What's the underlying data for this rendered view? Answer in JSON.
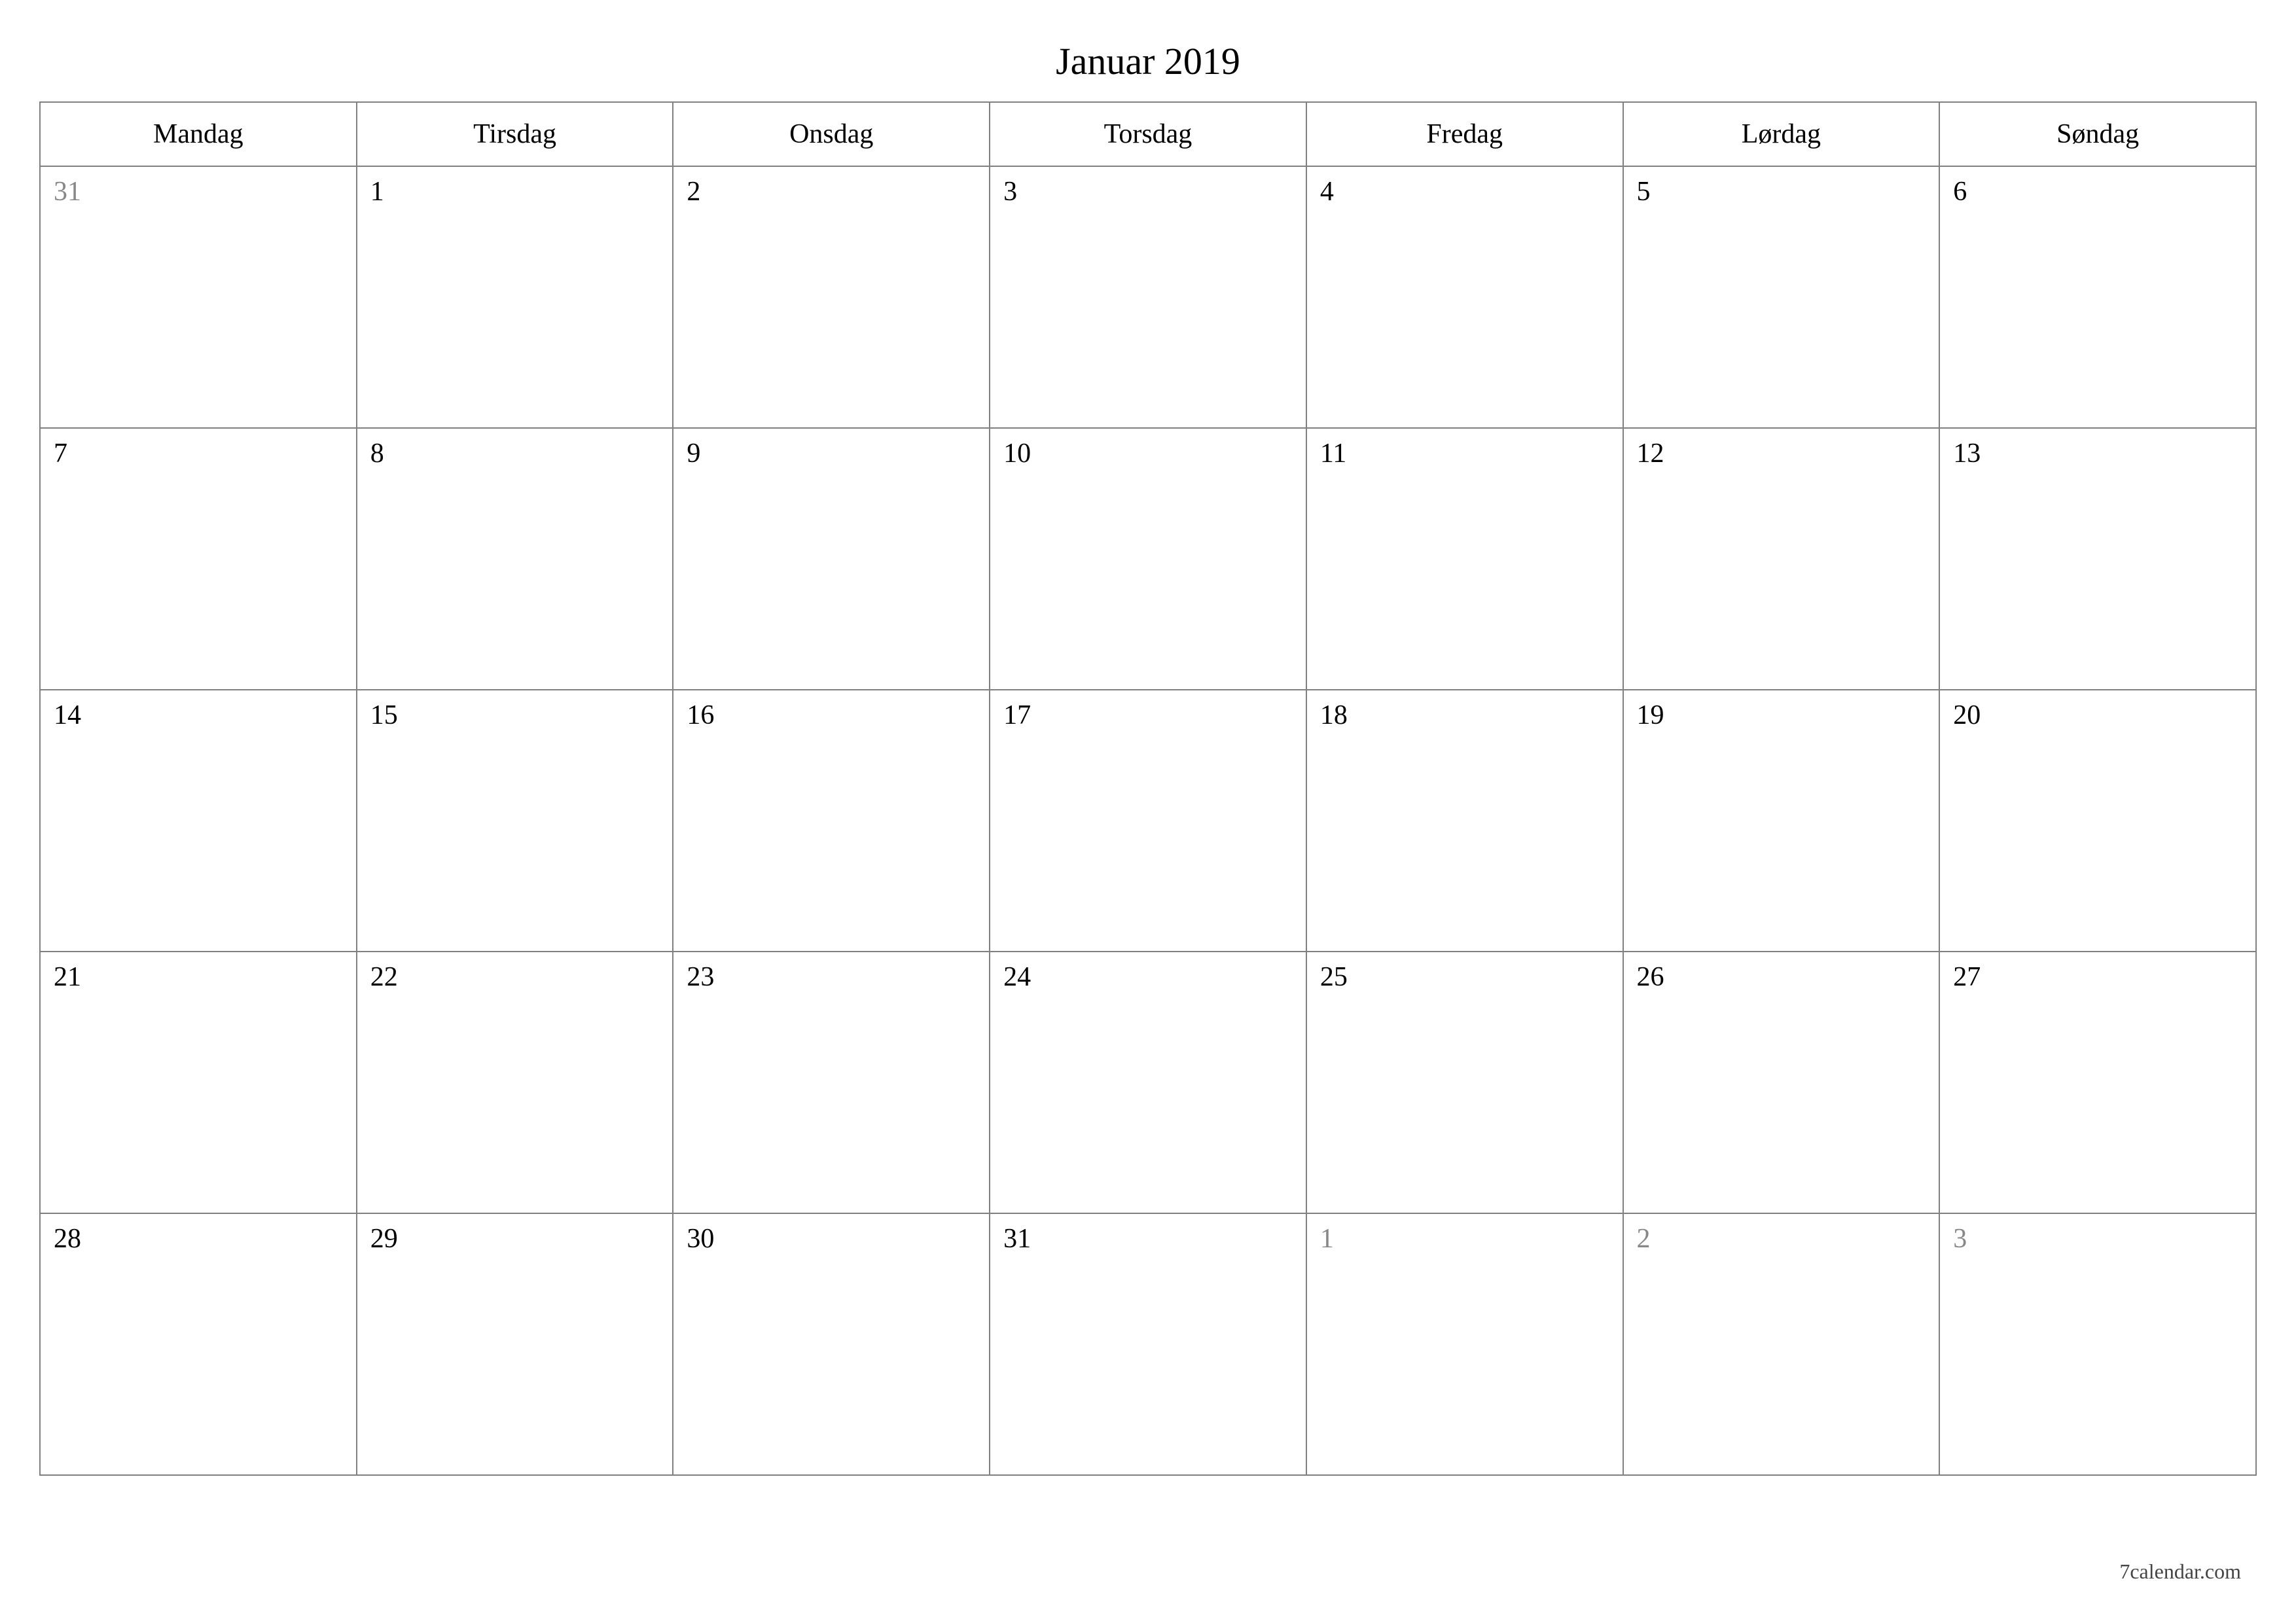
{
  "title": "Januar 2019",
  "weekdays": [
    "Mandag",
    "Tirsdag",
    "Onsdag",
    "Torsdag",
    "Fredag",
    "Lørdag",
    "Søndag"
  ],
  "weeks": [
    [
      {
        "day": "31",
        "other": true
      },
      {
        "day": "1",
        "other": false
      },
      {
        "day": "2",
        "other": false
      },
      {
        "day": "3",
        "other": false
      },
      {
        "day": "4",
        "other": false
      },
      {
        "day": "5",
        "other": false
      },
      {
        "day": "6",
        "other": false
      }
    ],
    [
      {
        "day": "7",
        "other": false
      },
      {
        "day": "8",
        "other": false
      },
      {
        "day": "9",
        "other": false
      },
      {
        "day": "10",
        "other": false
      },
      {
        "day": "11",
        "other": false
      },
      {
        "day": "12",
        "other": false
      },
      {
        "day": "13",
        "other": false
      }
    ],
    [
      {
        "day": "14",
        "other": false
      },
      {
        "day": "15",
        "other": false
      },
      {
        "day": "16",
        "other": false
      },
      {
        "day": "17",
        "other": false
      },
      {
        "day": "18",
        "other": false
      },
      {
        "day": "19",
        "other": false
      },
      {
        "day": "20",
        "other": false
      }
    ],
    [
      {
        "day": "21",
        "other": false
      },
      {
        "day": "22",
        "other": false
      },
      {
        "day": "23",
        "other": false
      },
      {
        "day": "24",
        "other": false
      },
      {
        "day": "25",
        "other": false
      },
      {
        "day": "26",
        "other": false
      },
      {
        "day": "27",
        "other": false
      }
    ],
    [
      {
        "day": "28",
        "other": false
      },
      {
        "day": "29",
        "other": false
      },
      {
        "day": "30",
        "other": false
      },
      {
        "day": "31",
        "other": false
      },
      {
        "day": "1",
        "other": true
      },
      {
        "day": "2",
        "other": true
      },
      {
        "day": "3",
        "other": true
      }
    ]
  ],
  "footer": "7calendar.com"
}
